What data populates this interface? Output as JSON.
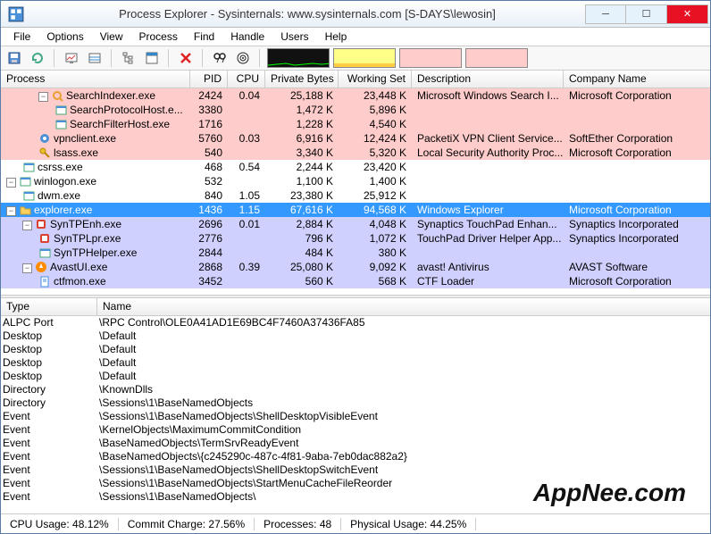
{
  "window": {
    "title": "Process Explorer - Sysinternals: www.sysinternals.com [S-DAYS\\lewosin]"
  },
  "menu": [
    "File",
    "Options",
    "View",
    "Process",
    "Find",
    "Handle",
    "Users",
    "Help"
  ],
  "columns": {
    "top": [
      "Process",
      "PID",
      "CPU",
      "Private Bytes",
      "Working Set",
      "Description",
      "Company Name"
    ],
    "bot": [
      "Type",
      "Name"
    ]
  },
  "processes": [
    {
      "indent": 2,
      "exp": "-",
      "icon": "search",
      "name": "SearchIndexer.exe",
      "pid": "2424",
      "cpu": "0.04",
      "priv": "25,188 K",
      "ws": "23,448 K",
      "desc": "Microsoft Windows Search I...",
      "comp": "Microsoft Corporation",
      "cls": "pink"
    },
    {
      "indent": 3,
      "exp": "",
      "icon": "app",
      "name": "SearchProtocolHost.e...",
      "pid": "3380",
      "cpu": "",
      "priv": "1,472 K",
      "ws": "5,896 K",
      "desc": "",
      "comp": "",
      "cls": "pink"
    },
    {
      "indent": 3,
      "exp": "",
      "icon": "app",
      "name": "SearchFilterHost.exe",
      "pid": "1716",
      "cpu": "",
      "priv": "1,228 K",
      "ws": "4,540 K",
      "desc": "",
      "comp": "",
      "cls": "pink"
    },
    {
      "indent": 2,
      "exp": "",
      "icon": "vpn",
      "name": "vpnclient.exe",
      "pid": "5760",
      "cpu": "0.03",
      "priv": "6,916 K",
      "ws": "12,424 K",
      "desc": "PacketiX VPN Client Service...",
      "comp": "SoftEther Corporation",
      "cls": "pink"
    },
    {
      "indent": 2,
      "exp": "",
      "icon": "key",
      "name": "lsass.exe",
      "pid": "540",
      "cpu": "",
      "priv": "3,340 K",
      "ws": "5,320 K",
      "desc": "Local Security Authority Proc...",
      "comp": "Microsoft Corporation",
      "cls": "pink"
    },
    {
      "indent": 1,
      "exp": "",
      "icon": "app",
      "name": "csrss.exe",
      "pid": "468",
      "cpu": "0.54",
      "priv": "2,244 K",
      "ws": "23,420 K",
      "desc": "",
      "comp": "",
      "cls": ""
    },
    {
      "indent": 0,
      "exp": "-",
      "icon": "app",
      "name": "winlogon.exe",
      "pid": "532",
      "cpu": "",
      "priv": "1,100 K",
      "ws": "1,400 K",
      "desc": "",
      "comp": "",
      "cls": ""
    },
    {
      "indent": 1,
      "exp": "",
      "icon": "app",
      "name": "dwm.exe",
      "pid": "840",
      "cpu": "1.05",
      "priv": "23,380 K",
      "ws": "25,912 K",
      "desc": "",
      "comp": "",
      "cls": ""
    },
    {
      "indent": 0,
      "exp": "-",
      "icon": "folder",
      "name": "explorer.exe",
      "pid": "1436",
      "cpu": "1.15",
      "priv": "67,616 K",
      "ws": "94,568 K",
      "desc": "Windows Explorer",
      "comp": "Microsoft Corporation",
      "cls": "selected"
    },
    {
      "indent": 1,
      "exp": "-",
      "icon": "syn",
      "name": "SynTPEnh.exe",
      "pid": "2696",
      "cpu": "0.01",
      "priv": "2,884 K",
      "ws": "4,048 K",
      "desc": "Synaptics TouchPad Enhan...",
      "comp": "Synaptics Incorporated",
      "cls": "blue"
    },
    {
      "indent": 2,
      "exp": "",
      "icon": "syn",
      "name": "SynTPLpr.exe",
      "pid": "2776",
      "cpu": "",
      "priv": "796 K",
      "ws": "1,072 K",
      "desc": "TouchPad Driver Helper App...",
      "comp": "Synaptics Incorporated",
      "cls": "blue"
    },
    {
      "indent": 2,
      "exp": "",
      "icon": "app",
      "name": "SynTPHelper.exe",
      "pid": "2844",
      "cpu": "",
      "priv": "484 K",
      "ws": "380 K",
      "desc": "",
      "comp": "",
      "cls": "blue"
    },
    {
      "indent": 1,
      "exp": "-",
      "icon": "avast",
      "name": "AvastUI.exe",
      "pid": "2868",
      "cpu": "0.39",
      "priv": "25,080 K",
      "ws": "9,092 K",
      "desc": "avast! Antivirus",
      "comp": "AVAST Software",
      "cls": "blue"
    },
    {
      "indent": 2,
      "exp": "",
      "icon": "doc",
      "name": "ctfmon.exe",
      "pid": "3452",
      "cpu": "",
      "priv": "560 K",
      "ws": "568 K",
      "desc": "CTF Loader",
      "comp": "Microsoft Corporation",
      "cls": "blue"
    }
  ],
  "handles": [
    {
      "type": "ALPC Port",
      "name": "\\RPC Control\\OLE0A41AD1E69BC4F7460A37436FA85"
    },
    {
      "type": "Desktop",
      "name": "\\Default"
    },
    {
      "type": "Desktop",
      "name": "\\Default"
    },
    {
      "type": "Desktop",
      "name": "\\Default"
    },
    {
      "type": "Desktop",
      "name": "\\Default"
    },
    {
      "type": "Directory",
      "name": "\\KnownDlls"
    },
    {
      "type": "Directory",
      "name": "\\Sessions\\1\\BaseNamedObjects"
    },
    {
      "type": "Event",
      "name": "\\Sessions\\1\\BaseNamedObjects\\ShellDesktopVisibleEvent"
    },
    {
      "type": "Event",
      "name": "\\KernelObjects\\MaximumCommitCondition"
    },
    {
      "type": "Event",
      "name": "\\BaseNamedObjects\\TermSrvReadyEvent"
    },
    {
      "type": "Event",
      "name": "\\BaseNamedObjects\\{c245290c-487c-4f81-9aba-7eb0dac882a2}"
    },
    {
      "type": "Event",
      "name": "\\Sessions\\1\\BaseNamedObjects\\ShellDesktopSwitchEvent"
    },
    {
      "type": "Event",
      "name": "\\Sessions\\1\\BaseNamedObjects\\StartMenuCacheFileReorder"
    },
    {
      "type": "Event",
      "name": "\\Sessions\\1\\BaseNamedObjects\\"
    }
  ],
  "status": {
    "cpu": "CPU Usage: 48.12%",
    "commit": "Commit Charge: 27.56%",
    "procs": "Processes: 48",
    "phys": "Physical Usage: 44.25%"
  },
  "watermark": "AppNee.com"
}
